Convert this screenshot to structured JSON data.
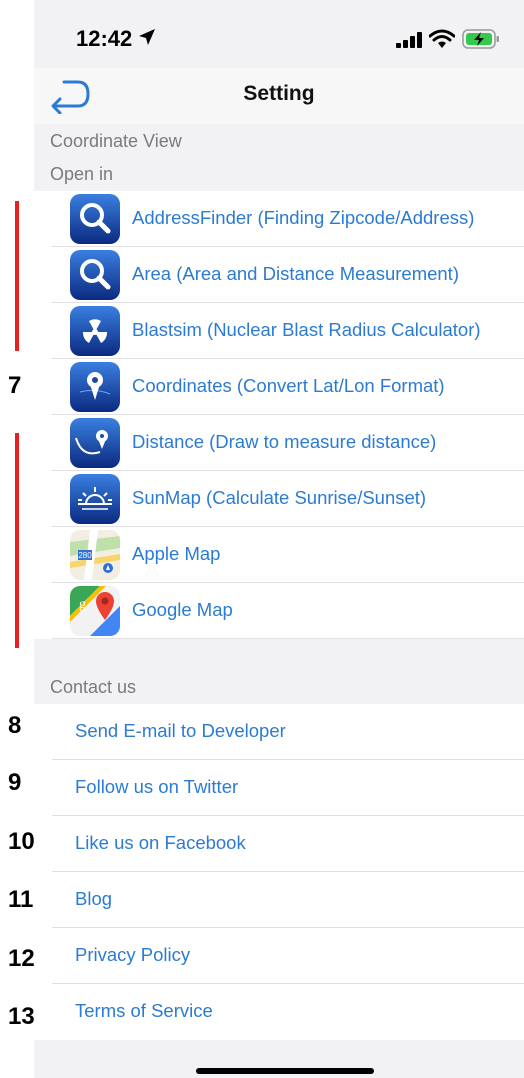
{
  "status": {
    "time": "12:42"
  },
  "nav": {
    "title": "Setting"
  },
  "sections": {
    "coordinate_view": "Coordinate View",
    "open_in": "Open in",
    "contact_us": "Contact us"
  },
  "apps": [
    {
      "label": "AddressFinder (Finding Zipcode/Address)",
      "icon": "magnifier-icon"
    },
    {
      "label": "Area (Area and Distance Measurement)",
      "icon": "magnifier-icon"
    },
    {
      "label": "Blastsim (Nuclear Blast Radius Calculator)",
      "icon": "radiation-icon"
    },
    {
      "label": "Coordinates (Convert Lat/Lon Format)",
      "icon": "map-pin-icon"
    },
    {
      "label": "Distance (Draw to measure distance)",
      "icon": "route-pin-icon"
    },
    {
      "label": "SunMap (Calculate Sunrise/Sunset)",
      "icon": "sunrise-icon"
    },
    {
      "label": "Apple Map",
      "icon": "apple-maps-icon"
    },
    {
      "label": "Google Map",
      "icon": "google-maps-icon"
    }
  ],
  "contact": [
    {
      "label": "Send E-mail to Developer"
    },
    {
      "label": "Follow us on Twitter"
    },
    {
      "label": "Like us on Facebook"
    },
    {
      "label": "Blog"
    },
    {
      "label": "Privacy Policy"
    },
    {
      "label": "Terms of Service"
    }
  ],
  "annotations": {
    "n7": "7",
    "n8": "8",
    "n9": "9",
    "n10": "10",
    "n11": "11",
    "n12": "12",
    "n13": "13"
  },
  "colors": {
    "link": "#2b7bd4",
    "annotation_bar": "#e8201e",
    "section_bg": "#f2f2f5"
  }
}
